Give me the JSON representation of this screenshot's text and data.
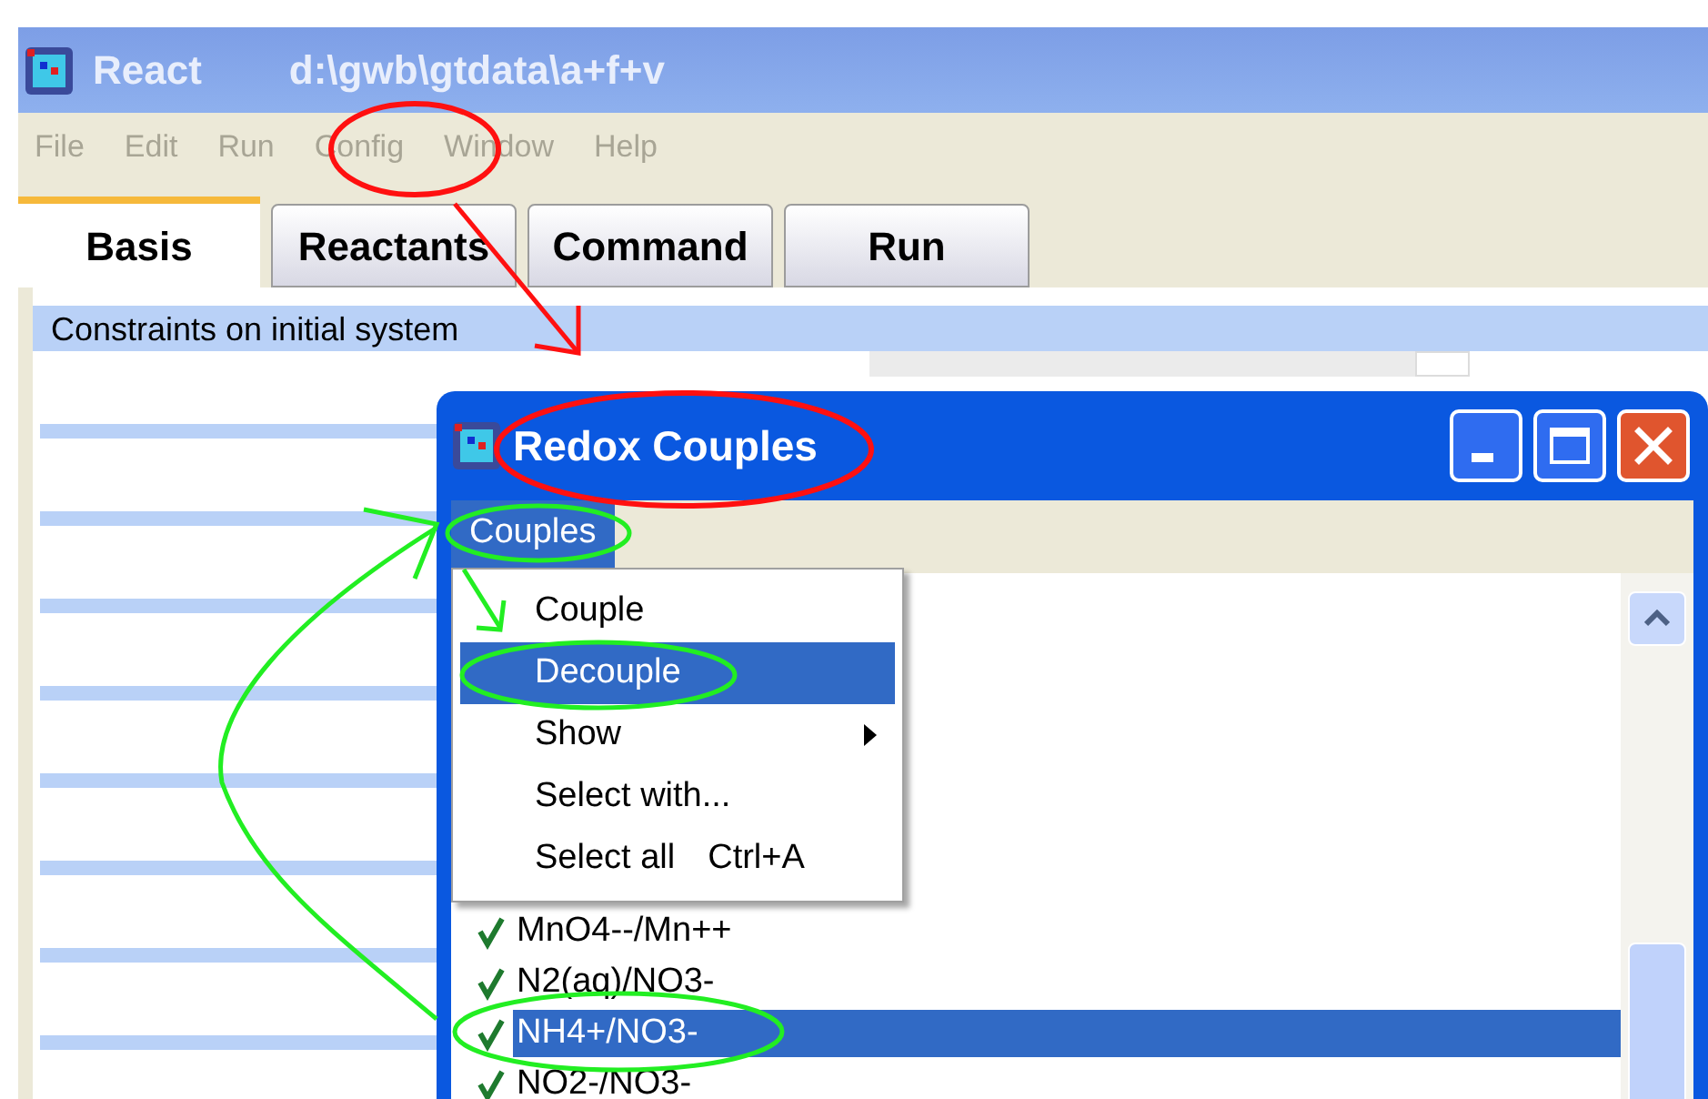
{
  "window": {
    "title": "React",
    "path": "d:\\gwb\\gtdata\\a+f+v"
  },
  "menu": [
    {
      "label": "File"
    },
    {
      "label": "Edit"
    },
    {
      "label": "Run"
    },
    {
      "label": "Config"
    },
    {
      "label": "Window"
    },
    {
      "label": "Help"
    }
  ],
  "tabs": [
    {
      "label": "Basis",
      "selected": true
    },
    {
      "label": "Reactants",
      "selected": false
    },
    {
      "label": "Command",
      "selected": false
    },
    {
      "label": "Run",
      "selected": false
    }
  ],
  "group_box": {
    "title": "Constraints on initial system"
  },
  "dialog": {
    "title": "Redox Couples",
    "menu": [
      {
        "label": "Couples",
        "selected": true
      }
    ],
    "popup": [
      {
        "label": "Couple",
        "selected": false,
        "submenu": false
      },
      {
        "label": "Decouple",
        "selected": true,
        "submenu": false
      },
      {
        "label": "Show",
        "selected": false,
        "submenu": true
      },
      {
        "label": "Select with...",
        "selected": false,
        "submenu": false
      },
      {
        "label": "Select all",
        "selected": false,
        "submenu": false,
        "shortcut": "Ctrl+A"
      }
    ],
    "couples": [
      {
        "label": "MnO4--/Mn++",
        "checked": true,
        "selected": false
      },
      {
        "label": "N2(aq)/NO3-",
        "checked": true,
        "selected": false
      },
      {
        "label": "NH4+/NO3-",
        "checked": true,
        "selected": true
      },
      {
        "label": "NO2-/NO3-",
        "checked": true,
        "selected": false
      }
    ]
  }
}
